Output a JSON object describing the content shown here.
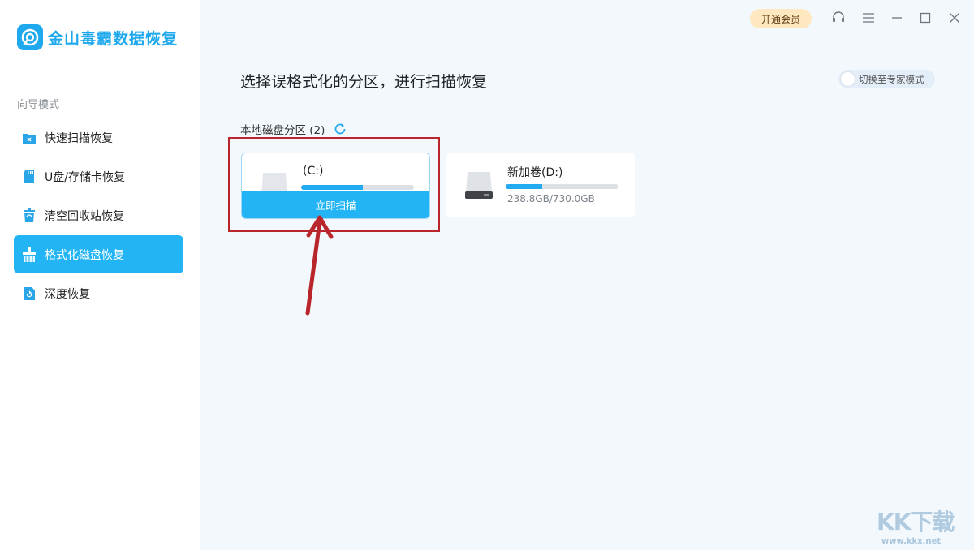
{
  "app": {
    "name": "金山毒霸数据恢复"
  },
  "sidebar": {
    "section_label": "向导模式",
    "items": [
      {
        "label": "快速扫描恢复",
        "icon": "folder-x-icon",
        "active": false
      },
      {
        "label": "U盘/存储卡恢复",
        "icon": "sd-card-icon",
        "active": false
      },
      {
        "label": "清空回收站恢复",
        "icon": "recycle-bin-icon",
        "active": false
      },
      {
        "label": "格式化磁盘恢复",
        "icon": "format-disk-icon",
        "active": true
      },
      {
        "label": "深度恢复",
        "icon": "deep-recovery-icon",
        "active": false
      }
    ]
  },
  "titlebar": {
    "vip_label": "开通会员",
    "icons": [
      "headset-icon",
      "menu-icon",
      "minimize-icon",
      "maximize-icon",
      "close-icon"
    ]
  },
  "main": {
    "title": "选择误格式化的分区，进行扫描恢复",
    "expert_toggle_label": "切换至专家模式",
    "disk_section_label": "本地磁盘分区 (2)",
    "disks": [
      {
        "name": "(C:)",
        "usage_fraction": 0.55,
        "scan_label": "立即扫描"
      },
      {
        "name": "新加卷(D:)",
        "size": "238.8GB/730.0GB",
        "usage_fraction": 0.327
      }
    ]
  },
  "watermark": {
    "logo": "KK下载",
    "url": "www.kkx.net"
  },
  "colors": {
    "accent": "#22b4f5",
    "highlight": "#b8262c",
    "vip": "#ffe7bf"
  }
}
